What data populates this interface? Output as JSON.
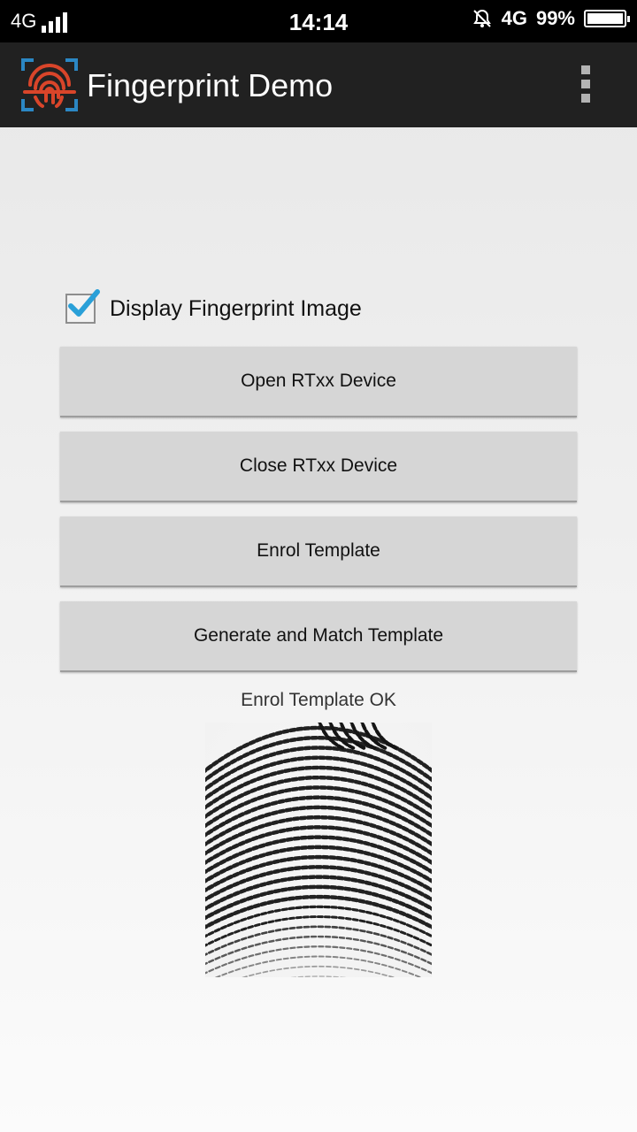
{
  "status_bar": {
    "network_left": "4G",
    "time": "14:14",
    "network_right": "4G",
    "battery_percent": "99%",
    "battery_level": 0.99
  },
  "app_bar": {
    "title": "Fingerprint Demo",
    "logo_icon": "fingerprint-scan-icon",
    "menu_icon": "overflow-menu-icon"
  },
  "main": {
    "checkbox": {
      "label": "Display Fingerprint Image",
      "checked": true,
      "accent": "#2aa0d8"
    },
    "buttons": [
      {
        "label": "Open RTxx Device"
      },
      {
        "label": "Close RTxx Device"
      },
      {
        "label": "Enrol Template"
      },
      {
        "label": "Generate and Match Template"
      }
    ],
    "status_text": "Enrol Template OK"
  },
  "colors": {
    "appbar": "#212121",
    "logo_red": "#d9452a",
    "logo_blue": "#2b87c4"
  }
}
